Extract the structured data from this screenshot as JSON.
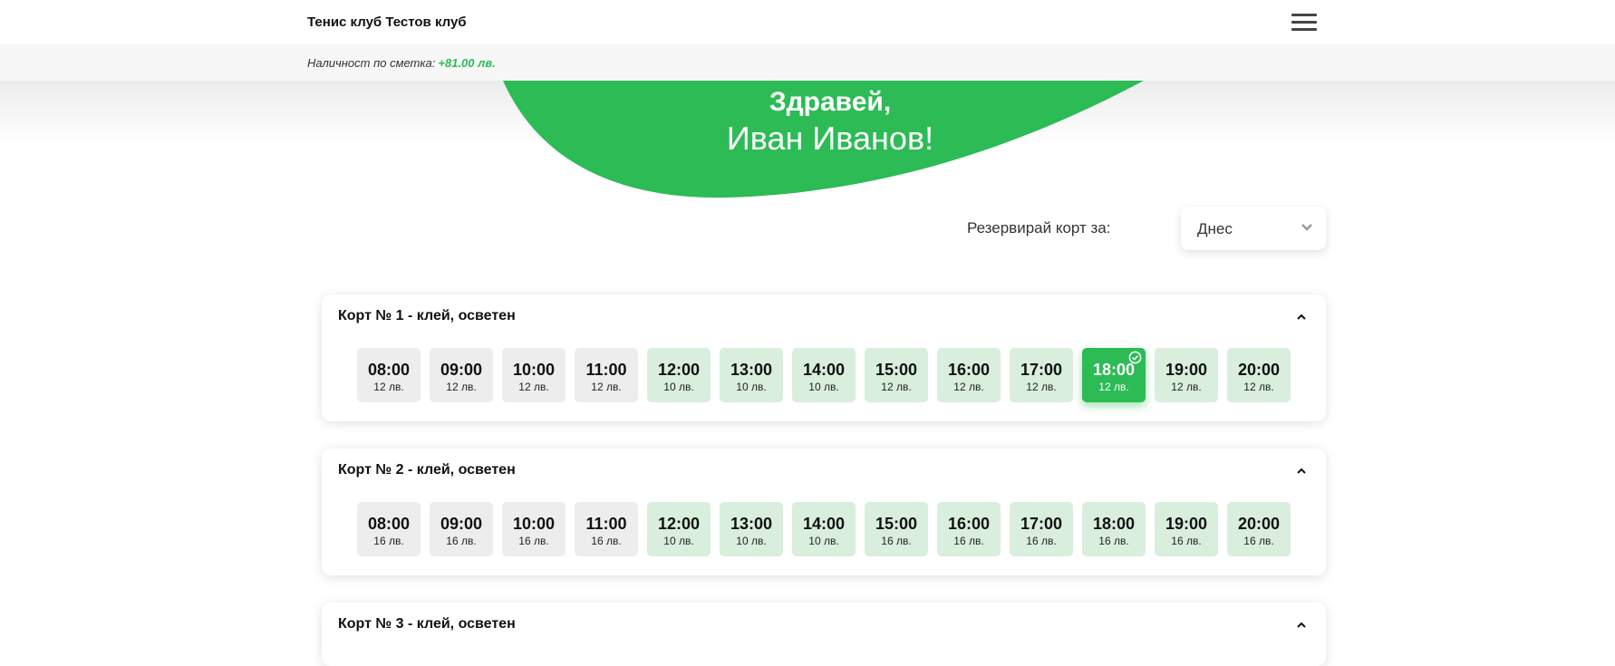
{
  "header": {
    "club_name": "Тенис клуб Тестов клуб",
    "menu_icon": "hamburger-menu-icon"
  },
  "balance": {
    "label": "Наличност по сметка:",
    "amount": "+81.00 лв."
  },
  "greeting": {
    "line1": "Здравей,",
    "line2": "Иван Иванов!"
  },
  "reserve": {
    "label": "Резервирай корт за:",
    "selected_day": "Днес"
  },
  "colors": {
    "accent": "#2cbb55",
    "free_slot": "#d9eedd",
    "past_slot": "#ededed"
  },
  "courts": [
    {
      "title": "Корт № 1 - клей, осветен",
      "slots": [
        {
          "time": "08:00",
          "price": "12 лв.",
          "state": "past"
        },
        {
          "time": "09:00",
          "price": "12 лв.",
          "state": "past"
        },
        {
          "time": "10:00",
          "price": "12 лв.",
          "state": "past"
        },
        {
          "time": "11:00",
          "price": "12 лв.",
          "state": "past"
        },
        {
          "time": "12:00",
          "price": "10 лв.",
          "state": "free"
        },
        {
          "time": "13:00",
          "price": "10 лв.",
          "state": "free"
        },
        {
          "time": "14:00",
          "price": "10 лв.",
          "state": "free"
        },
        {
          "time": "15:00",
          "price": "12 лв.",
          "state": "free"
        },
        {
          "time": "16:00",
          "price": "12 лв.",
          "state": "free"
        },
        {
          "time": "17:00",
          "price": "12 лв.",
          "state": "free"
        },
        {
          "time": "18:00",
          "price": "12 лв.",
          "state": "selected"
        },
        {
          "time": "19:00",
          "price": "12 лв.",
          "state": "free"
        },
        {
          "time": "20:00",
          "price": "12 лв.",
          "state": "free"
        }
      ]
    },
    {
      "title": "Корт № 2 - клей, осветен",
      "slots": [
        {
          "time": "08:00",
          "price": "16 лв.",
          "state": "past"
        },
        {
          "time": "09:00",
          "price": "16 лв.",
          "state": "past"
        },
        {
          "time": "10:00",
          "price": "16 лв.",
          "state": "past"
        },
        {
          "time": "11:00",
          "price": "16 лв.",
          "state": "past"
        },
        {
          "time": "12:00",
          "price": "10 лв.",
          "state": "free"
        },
        {
          "time": "13:00",
          "price": "10 лв.",
          "state": "free"
        },
        {
          "time": "14:00",
          "price": "10 лв.",
          "state": "free"
        },
        {
          "time": "15:00",
          "price": "16 лв.",
          "state": "free"
        },
        {
          "time": "16:00",
          "price": "16 лв.",
          "state": "free"
        },
        {
          "time": "17:00",
          "price": "16 лв.",
          "state": "free"
        },
        {
          "time": "18:00",
          "price": "16 лв.",
          "state": "free"
        },
        {
          "time": "19:00",
          "price": "16 лв.",
          "state": "free"
        },
        {
          "time": "20:00",
          "price": "16 лв.",
          "state": "free"
        }
      ]
    },
    {
      "title": "Корт № 3 - клей, осветен",
      "slots": []
    }
  ]
}
